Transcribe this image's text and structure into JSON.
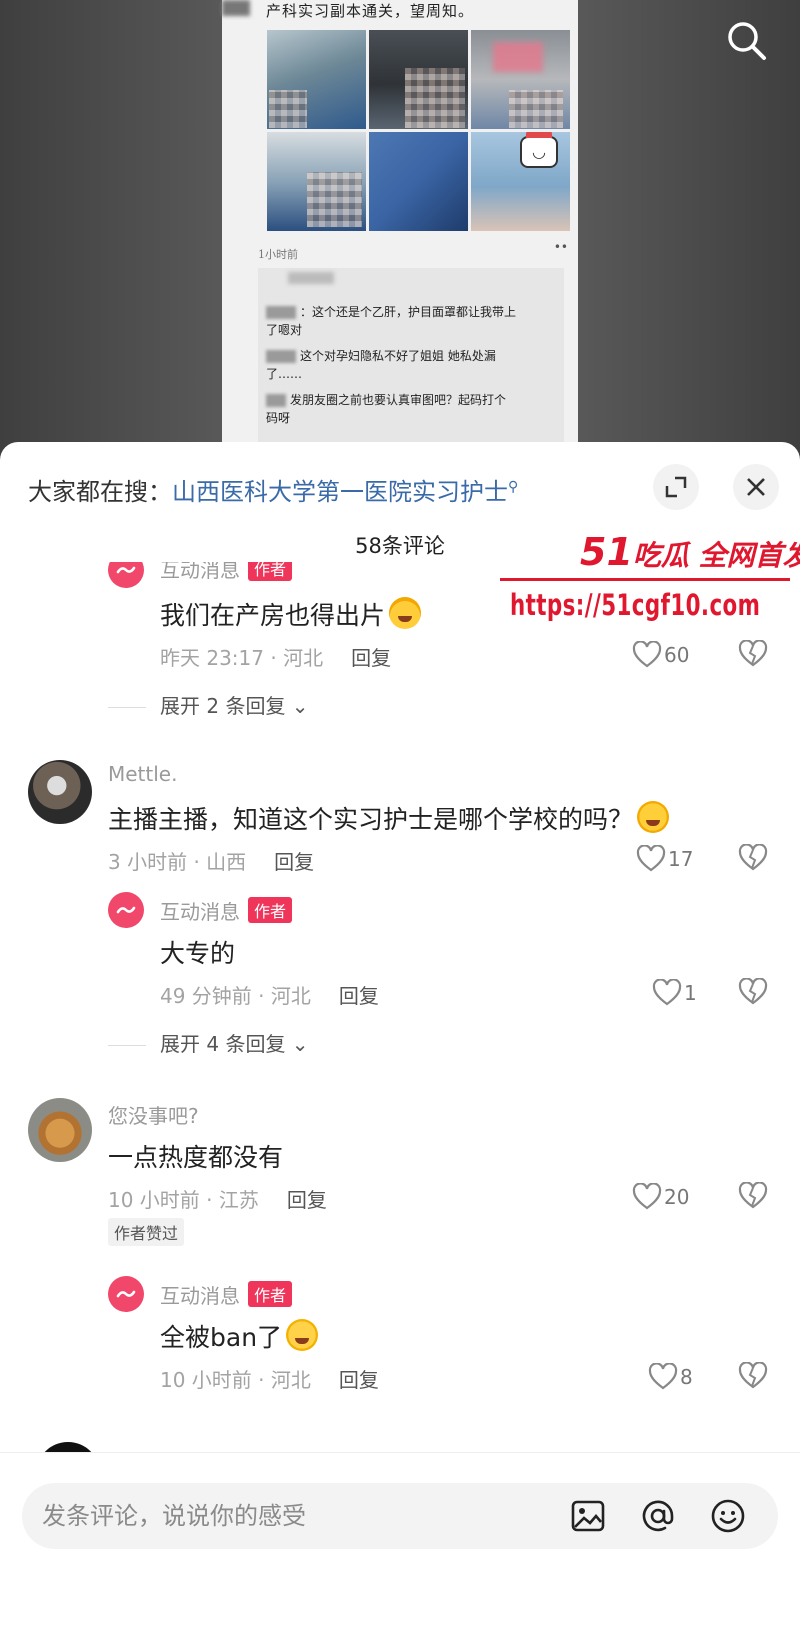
{
  "post": {
    "caption": "产科实习副本通关，望周知。",
    "time": "1小时前",
    "more": "••",
    "comment_lines": [
      "：这个还是个乙肝，护目面罩都让我带上",
      "了嗯对",
      "这个对孕妇隐私不好了姐姐 她私处漏",
      "了……",
      "发朋友圈之前也要认真审图吧？起码打个",
      "码呀"
    ]
  },
  "header": {
    "search_prefix": "大家都在搜：",
    "search_term": "山西医科大学第一医院实习护士",
    "comment_count": "58条评论"
  },
  "watermark": {
    "title_num": "51",
    "title_text": "吃瓜 全网首发",
    "url": "https://51cgf10.com"
  },
  "comments": [
    {
      "reply_user": "互动消息",
      "author_tag": "作者",
      "reply_text": "我们在产房也得出片",
      "reply_time": "昨天 23:17 · 河北",
      "reply_label": "回复",
      "reply_likes": "60",
      "expand": "展开 2 条回复 ⌄"
    },
    {
      "user": "Mettle.",
      "text": "主播主播，知道这个实习护士是哪个学校的吗？",
      "time": "3 小时前 · 山西",
      "reply_label": "回复",
      "likes": "17",
      "reply_user": "互动消息",
      "author_tag": "作者",
      "reply_text": "大专的",
      "reply_time": "49 分钟前 · 河北",
      "reply_likes": "1",
      "expand": "展开 4 条回复 ⌄"
    },
    {
      "user": "您没事吧?",
      "text": "一点热度都没有",
      "time": "10 小时前 · 江苏",
      "reply_label": "回复",
      "likes": "20",
      "liked_badge": "作者赞过",
      "reply_user": "互动消息",
      "author_tag": "作者",
      "reply_text": "全被ban了",
      "reply_time": "10 小时前 · 河北",
      "reply_likes": "8"
    }
  ],
  "input": {
    "placeholder": "发条评论，说说你的感受"
  },
  "colors": {
    "accent_red": "#f0355b",
    "link_blue": "#3a6aa8",
    "watermark_red": "#e0182f"
  }
}
